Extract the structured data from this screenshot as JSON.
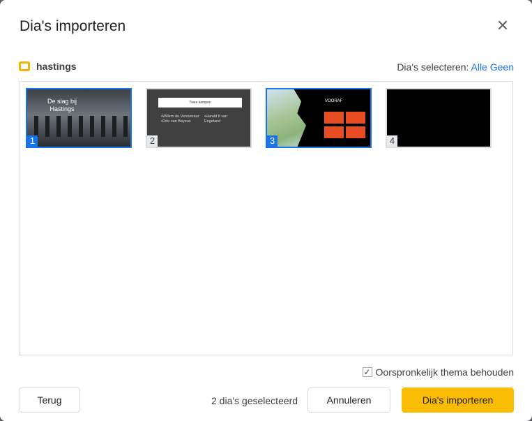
{
  "dialog": {
    "title": "Dia's importeren",
    "close_icon": "close-icon"
  },
  "file": {
    "name": "hastings",
    "icon": "slides-file-icon",
    "icon_color": "#f4b400"
  },
  "select": {
    "label": "Dia's selecteren:",
    "all": "Alle",
    "none": "Geen"
  },
  "slides": [
    {
      "number": "1",
      "selected": true,
      "title": "De slag bij Hastings"
    },
    {
      "number": "2",
      "selected": false,
      "title": "Twee kampen",
      "col1": [
        "•Willem de Veroveraar",
        "•Odo van Bayeux"
      ],
      "col2": [
        "•Harald II van Engeland"
      ]
    },
    {
      "number": "3",
      "selected": true,
      "title": "VOORAF"
    },
    {
      "number": "4",
      "selected": false
    }
  ],
  "footer": {
    "keep_theme": "Oorspronkelijk thema behouden",
    "keep_theme_checked": true,
    "back": "Terug",
    "count": "2 dia's geselecteerd",
    "cancel": "Annuleren",
    "import": "Dia's importeren"
  },
  "colors": {
    "accent": "#1a73e8",
    "primary_button": "#fbbc04"
  }
}
